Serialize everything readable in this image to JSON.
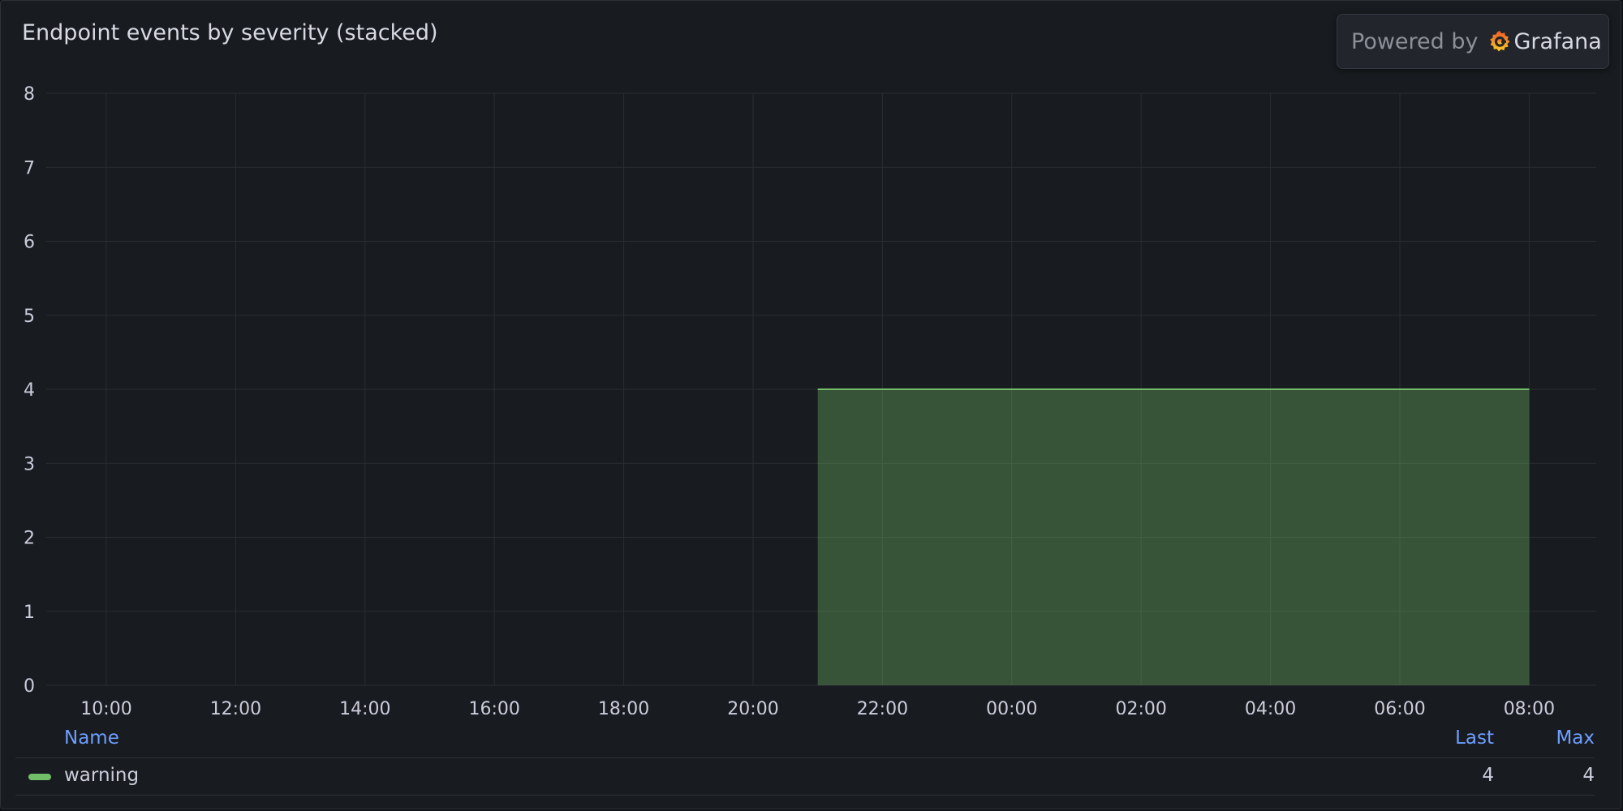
{
  "panel": {
    "title": "Endpoint events by severity (stacked)"
  },
  "badge": {
    "powered_by": "Powered by",
    "brand": "Grafana"
  },
  "chart_data": {
    "type": "area",
    "stacked": true,
    "title": "Endpoint events by severity (stacked)",
    "x_ticks": [
      "10:00",
      "12:00",
      "14:00",
      "16:00",
      "18:00",
      "20:00",
      "22:00",
      "00:00",
      "02:00",
      "04:00",
      "06:00",
      "08:00"
    ],
    "y_ticks": [
      0,
      1,
      2,
      3,
      4,
      5,
      6,
      7,
      8
    ],
    "xlim": [
      "09:05",
      "09:05 (+1 day)"
    ],
    "ylim": [
      0,
      8
    ],
    "grid": true,
    "series": [
      {
        "name": "warning",
        "color": "#73bf69",
        "points": [
          {
            "x": "21:00",
            "y": 4
          },
          {
            "x": "08:00",
            "y": 4
          }
        ]
      }
    ],
    "legend": {
      "placement": "bottom",
      "columns": [
        "Name",
        "Last",
        "Max"
      ],
      "rows": [
        {
          "name": "warning",
          "last": "4",
          "max": "4",
          "color": "#73bf69"
        }
      ]
    }
  }
}
